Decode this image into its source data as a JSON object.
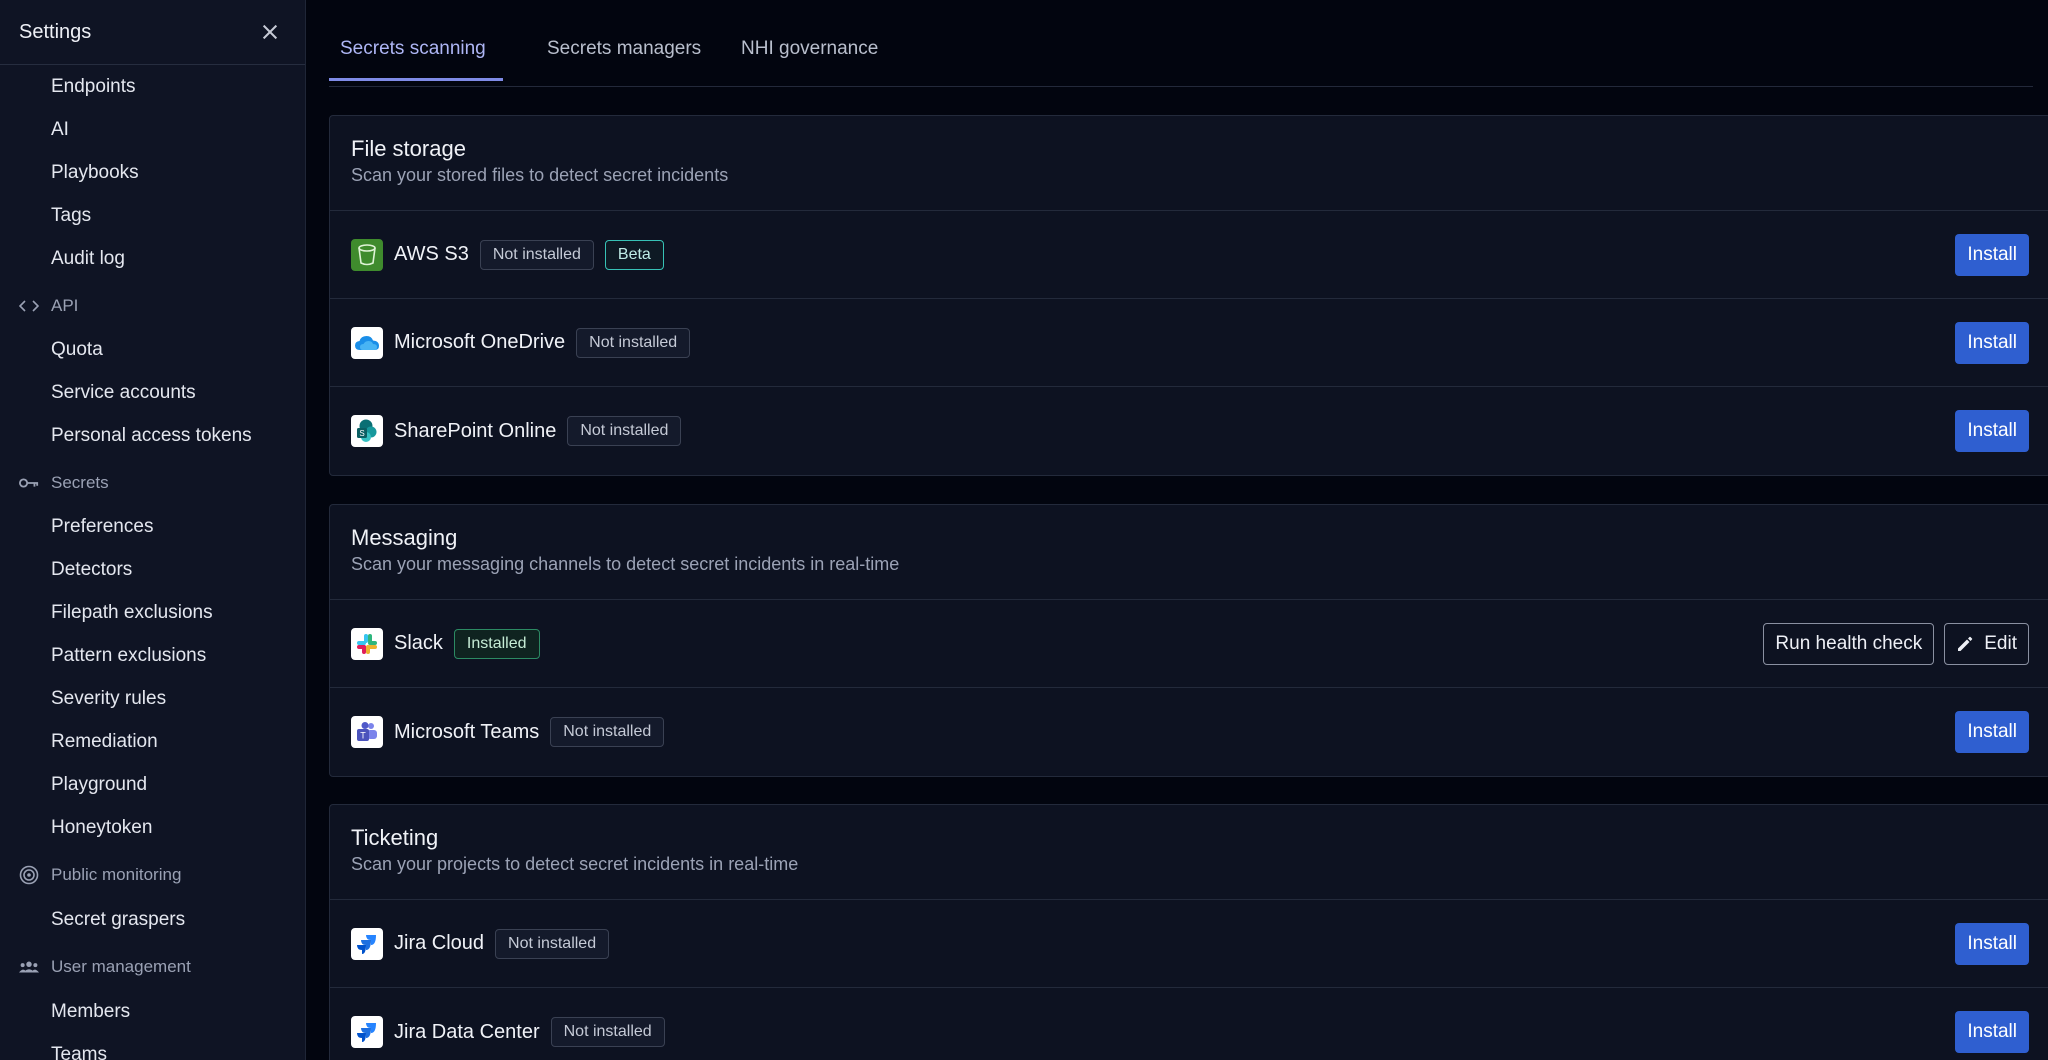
{
  "sidebar": {
    "title": "Settings",
    "close_icon": "close-icon",
    "items": [
      {
        "type": "item",
        "label": "Endpoints"
      },
      {
        "type": "item",
        "label": "AI"
      },
      {
        "type": "item",
        "label": "Playbooks"
      },
      {
        "type": "item",
        "label": "Tags"
      },
      {
        "type": "item",
        "label": "Audit log"
      },
      {
        "type": "group",
        "label": "API",
        "icon": "code-icon"
      },
      {
        "type": "item",
        "label": "Quota"
      },
      {
        "type": "item",
        "label": "Service accounts"
      },
      {
        "type": "item",
        "label": "Personal access tokens"
      },
      {
        "type": "group",
        "label": "Secrets",
        "icon": "key-icon"
      },
      {
        "type": "item",
        "label": "Preferences"
      },
      {
        "type": "item",
        "label": "Detectors"
      },
      {
        "type": "item",
        "label": "Filepath exclusions"
      },
      {
        "type": "item",
        "label": "Pattern exclusions"
      },
      {
        "type": "item",
        "label": "Severity rules"
      },
      {
        "type": "item",
        "label": "Remediation"
      },
      {
        "type": "item",
        "label": "Playground"
      },
      {
        "type": "item",
        "label": "Honeytoken"
      },
      {
        "type": "group",
        "label": "Public monitoring",
        "icon": "radar-icon"
      },
      {
        "type": "item",
        "label": "Secret graspers"
      },
      {
        "type": "group",
        "label": "User management",
        "icon": "users-icon"
      },
      {
        "type": "item",
        "label": "Members"
      },
      {
        "type": "item",
        "label": "Teams"
      }
    ]
  },
  "tabs": [
    {
      "label": "Secrets scanning",
      "active": true
    },
    {
      "label": "Secrets managers",
      "active": false
    },
    {
      "label": "NHI governance",
      "active": false
    }
  ],
  "sections": [
    {
      "title": "File storage",
      "subtitle": "Scan your stored files to detect secret incidents",
      "integrations": [
        {
          "name": "AWS S3",
          "icon": "aws-s3-icon",
          "status": "Not installed",
          "extra_badge": "Beta",
          "action": "Install"
        },
        {
          "name": "Microsoft OneDrive",
          "icon": "onedrive-icon",
          "status": "Not installed",
          "action": "Install"
        },
        {
          "name": "SharePoint Online",
          "icon": "sharepoint-icon",
          "status": "Not installed",
          "action": "Install"
        }
      ]
    },
    {
      "title": "Messaging",
      "subtitle": "Scan your messaging channels to detect secret incidents in real-time",
      "integrations": [
        {
          "name": "Slack",
          "icon": "slack-icon",
          "status": "Installed",
          "health_check_label": "Run health check",
          "edit_label": "Edit"
        },
        {
          "name": "Microsoft Teams",
          "icon": "teams-icon",
          "status": "Not installed",
          "action": "Install"
        }
      ]
    },
    {
      "title": "Ticketing",
      "subtitle": "Scan your projects to detect secret incidents in real-time",
      "integrations": [
        {
          "name": "Jira Cloud",
          "icon": "jira-icon",
          "status": "Not installed",
          "action": "Install"
        },
        {
          "name": "Jira Data Center",
          "icon": "jira-icon",
          "status": "Not installed",
          "action": "Install"
        }
      ]
    }
  ],
  "colors": {
    "background": "#02050f",
    "sidebar": "#0f1424",
    "accent": "#2f5fd0",
    "tab_active": "#aeb6f5",
    "beta_border": "#37c2b6",
    "installed_border": "#2c8a63"
  }
}
